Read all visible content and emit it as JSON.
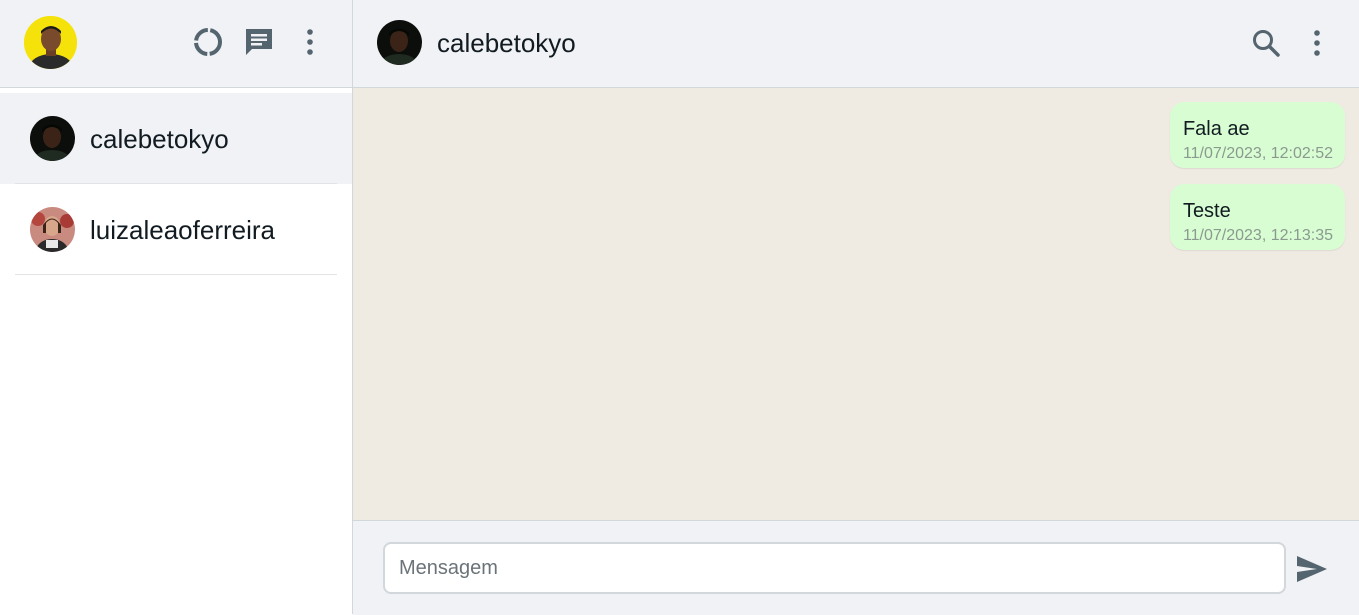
{
  "colors": {
    "header_bg": "#f0f2f5",
    "chat_bg": "#efeae2",
    "outgoing_bubble": "#d9fdd3",
    "icon_gray": "#54656f"
  },
  "sidebar": {
    "header": {
      "icons": [
        "status-icon",
        "new-chat-icon",
        "menu-icon"
      ]
    },
    "chats": [
      {
        "name": "calebetokyo",
        "active": true
      },
      {
        "name": "luizaleaoferreira",
        "active": false
      }
    ]
  },
  "conversation": {
    "contact_name": "calebetokyo",
    "header_icons": [
      "search-icon",
      "menu-icon"
    ],
    "messages": [
      {
        "text": "Fala ae",
        "time": "11/07/2023, 12:02:52",
        "outgoing": true
      },
      {
        "text": "Teste",
        "time": "11/07/2023, 12:13:35",
        "outgoing": true
      }
    ]
  },
  "composer": {
    "placeholder": "Mensagem",
    "value": "",
    "send_icon": "send-icon"
  }
}
